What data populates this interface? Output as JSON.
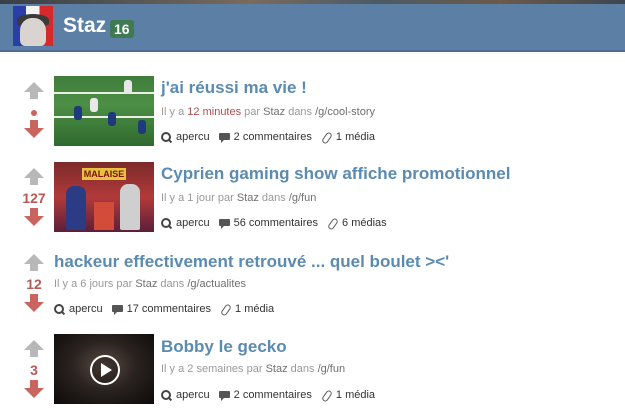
{
  "header": {
    "username": "Staz",
    "badge": "16"
  },
  "labels": {
    "ago_prefix": "Il y a ",
    "by": " par ",
    "in": " dans ",
    "apercu": "apercu"
  },
  "posts": [
    {
      "title": "j'ai réussi ma vie !",
      "score": "",
      "ago": "12 minutes",
      "author": "Staz",
      "category": "/g/cool-story",
      "comments": "2 commentaires",
      "media": "1 média"
    },
    {
      "title": "Cyprien gaming show affiche promotionnel",
      "score": "127",
      "ago": "1 jour",
      "author": "Staz",
      "category": "/g/fun",
      "comments": "56 commentaires",
      "media": "6 médias",
      "thumb_sign": "MALAISE"
    },
    {
      "title": "hackeur effectivement retrouvé ... quel boulet ><'",
      "score": "12",
      "ago": "6 jours",
      "author": "Staz",
      "category": "/g/actualites",
      "comments": "17 commentaires",
      "media": "1 média"
    },
    {
      "title": "Bobby le gecko",
      "score": "3",
      "ago": "2 semaines",
      "author": "Staz",
      "category": "/g/fun",
      "comments": "2 commentaires",
      "media": "1 média"
    }
  ]
}
